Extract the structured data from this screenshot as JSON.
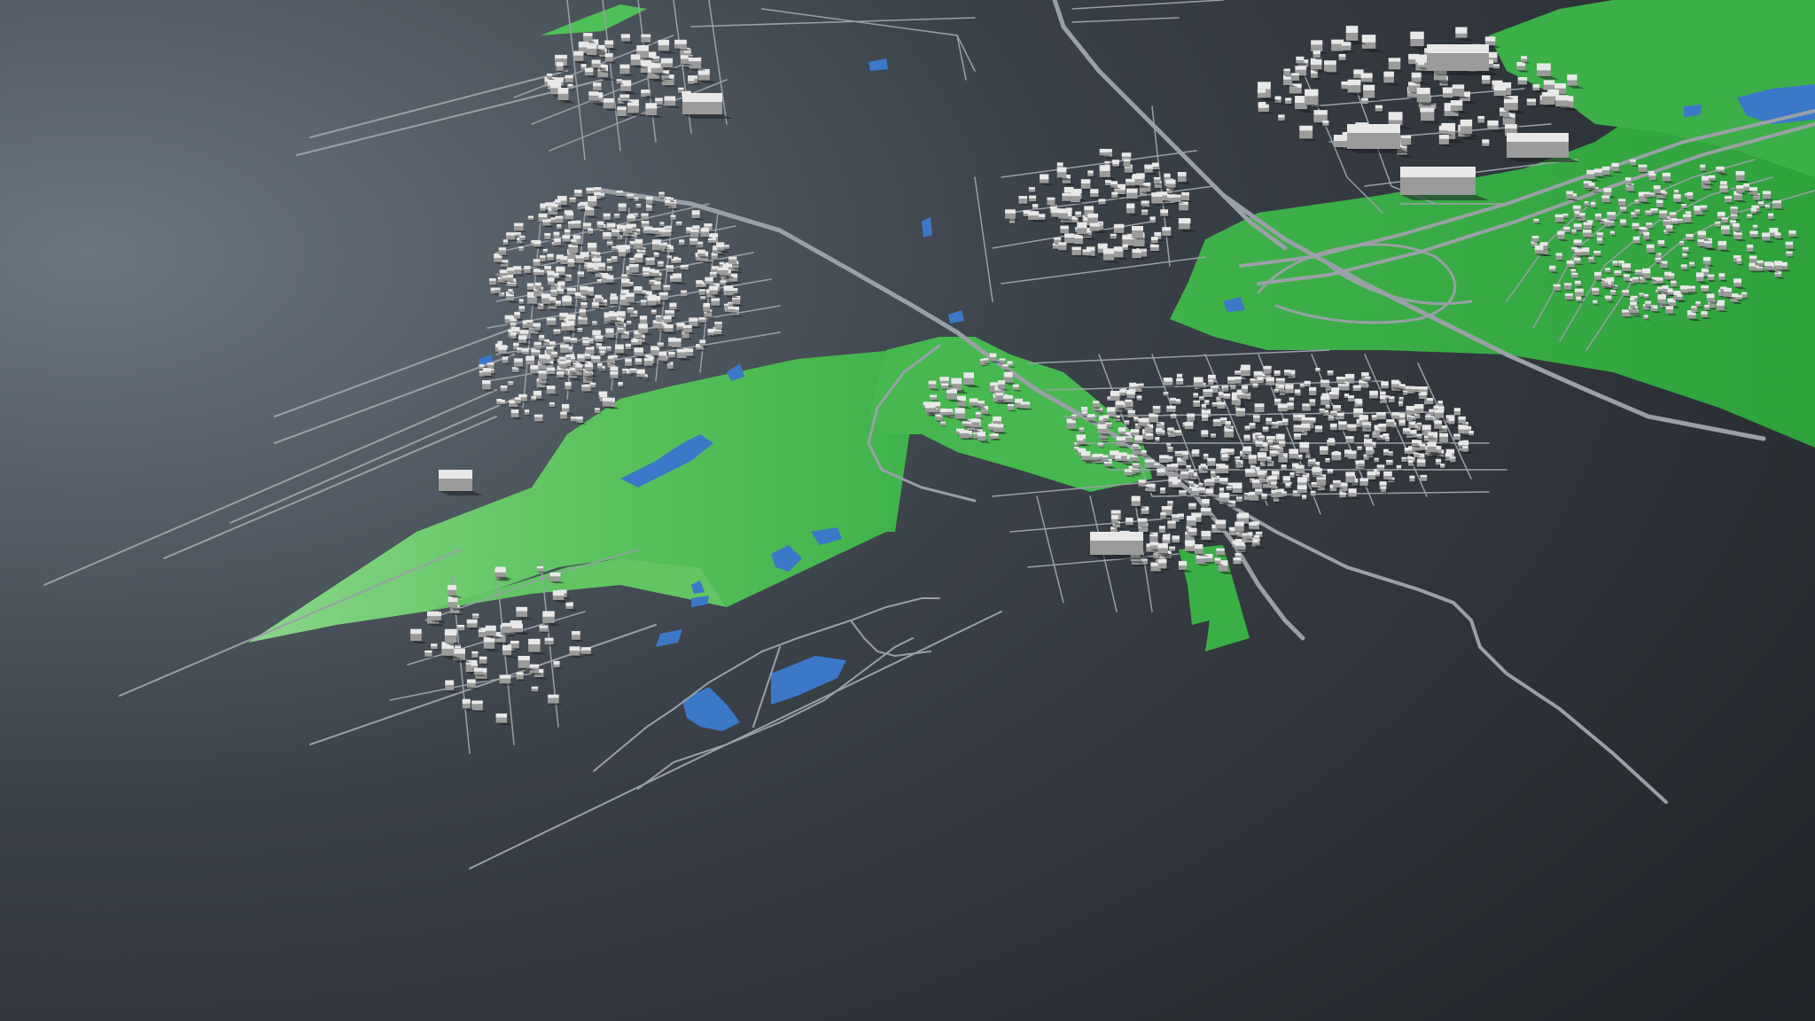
{
  "scene": {
    "description_visible_text": "",
    "colors": {
      "background_light": "#5f6a75",
      "background_dark": "#23272d",
      "park_light": "#7ccc7a",
      "park_mid": "#3fb24a",
      "park_dark": "#2f9a3c",
      "water": "#3b78c8",
      "road": "#9aa0a7",
      "road_edge": "#c3c7cc",
      "building_top": "#e8e8e8",
      "building_side": "#9b9b9b",
      "building_shadow": "#1c1f23"
    },
    "map_layers": [
      "ground",
      "parks",
      "water",
      "roads",
      "buildings"
    ]
  }
}
